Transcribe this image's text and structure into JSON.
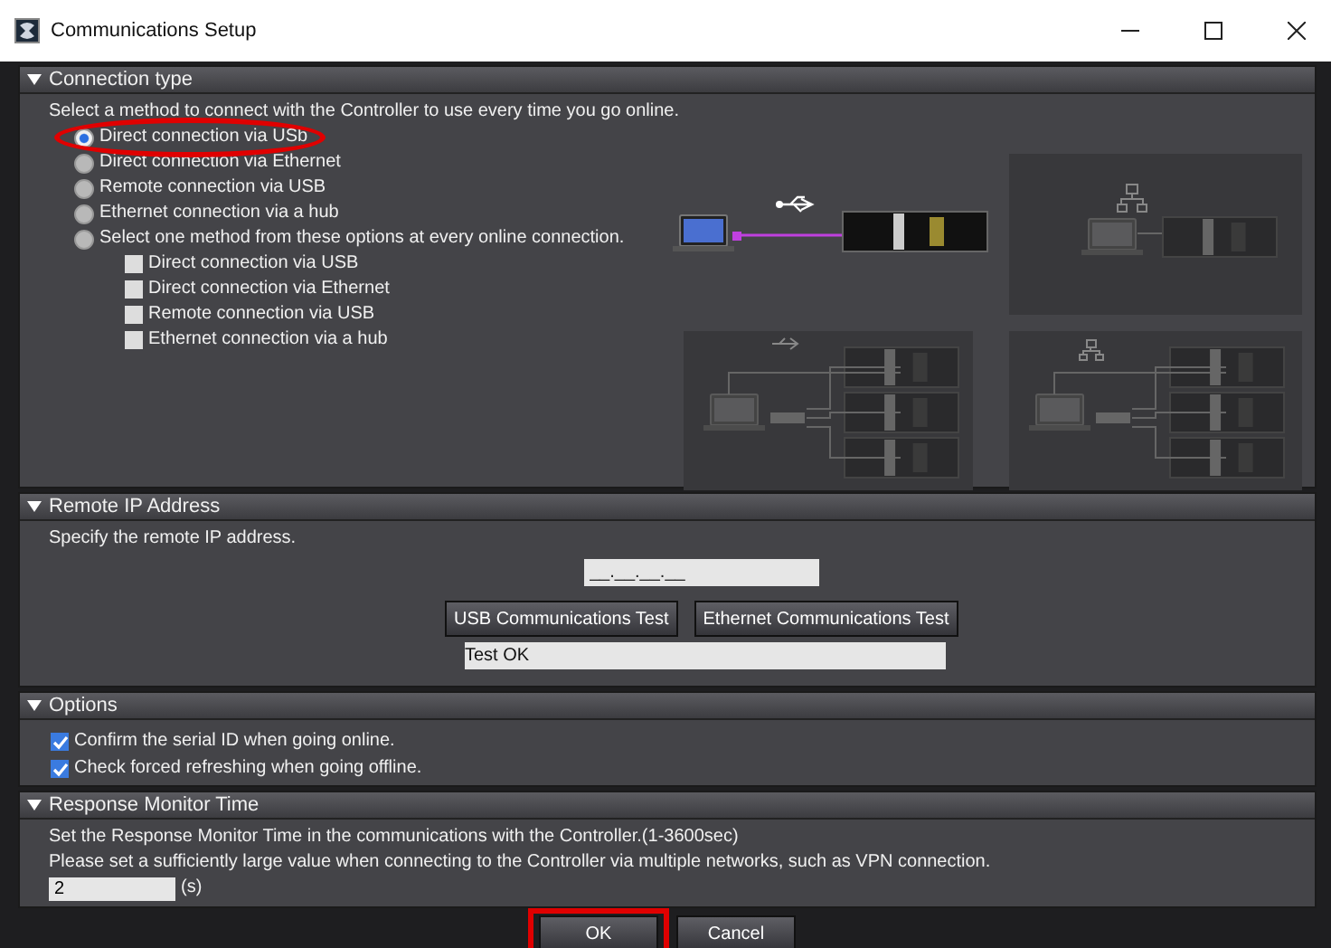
{
  "window": {
    "title": "Communications Setup"
  },
  "sections": [
    {
      "kind": "connection",
      "title": "Connection type",
      "expanded": true,
      "instruction": "Select a method to connect with the Controller to use every time you go online.",
      "methods": [
        {
          "label": "Direct connection via USb",
          "selected": true
        },
        {
          "label": "Direct connection via Ethernet",
          "selected": false
        },
        {
          "label": "Remote connection via USB",
          "selected": false
        },
        {
          "label": "Ethernet connection via a hub",
          "selected": false
        },
        {
          "label": "Select one method from these options at every online connection.",
          "selected": false
        }
      ],
      "sub_options": [
        {
          "label": "Direct connection via USB",
          "checked": false
        },
        {
          "label": "Direct connection via Ethernet",
          "checked": false
        },
        {
          "label": "Remote connection via USB",
          "checked": false
        },
        {
          "label": "Ethernet connection via a hub",
          "checked": false
        }
      ]
    },
    {
      "kind": "remote",
      "title": "Remote IP Address",
      "expanded": true,
      "instruction": "Specify the remote IP address.",
      "ip_placeholder": "__.__.__.__",
      "buttons": [
        "USB Communications Test",
        "Ethernet Communications Test"
      ],
      "result": "Test OK"
    },
    {
      "kind": "options",
      "title": "Options",
      "expanded": true,
      "options": [
        {
          "label": "Confirm the serial ID when going online.",
          "checked": true
        },
        {
          "label": "Check forced refreshing when going offline.",
          "checked": true
        }
      ]
    },
    {
      "kind": "monitor",
      "title": "Response Monitor Time",
      "expanded": true,
      "lines": [
        "Set the Response Monitor Time in the communications with the Controller.(1-3600sec)",
        "Please set a sufficiently large value when connecting to the Controller via multiple networks, such as VPN connection."
      ],
      "value": "2",
      "unit": "(s)"
    }
  ],
  "buttons": [
    "OK",
    "Cancel"
  ]
}
